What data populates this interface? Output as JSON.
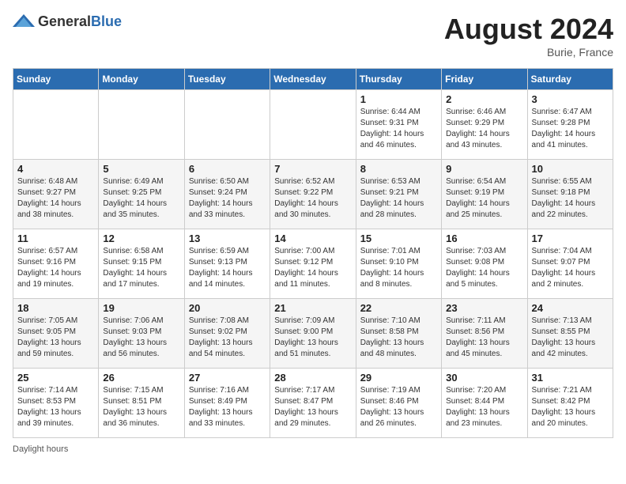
{
  "header": {
    "logo_general": "General",
    "logo_blue": "Blue",
    "month_year": "August 2024",
    "location": "Burie, France"
  },
  "days_of_week": [
    "Sunday",
    "Monday",
    "Tuesday",
    "Wednesday",
    "Thursday",
    "Friday",
    "Saturday"
  ],
  "weeks": [
    [
      {
        "day": "",
        "sunrise": "",
        "sunset": "",
        "daylight": ""
      },
      {
        "day": "",
        "sunrise": "",
        "sunset": "",
        "daylight": ""
      },
      {
        "day": "",
        "sunrise": "",
        "sunset": "",
        "daylight": ""
      },
      {
        "day": "",
        "sunrise": "",
        "sunset": "",
        "daylight": ""
      },
      {
        "day": "1",
        "sunrise": "Sunrise: 6:44 AM",
        "sunset": "Sunset: 9:31 PM",
        "daylight": "Daylight: 14 hours and 46 minutes."
      },
      {
        "day": "2",
        "sunrise": "Sunrise: 6:46 AM",
        "sunset": "Sunset: 9:29 PM",
        "daylight": "Daylight: 14 hours and 43 minutes."
      },
      {
        "day": "3",
        "sunrise": "Sunrise: 6:47 AM",
        "sunset": "Sunset: 9:28 PM",
        "daylight": "Daylight: 14 hours and 41 minutes."
      }
    ],
    [
      {
        "day": "4",
        "sunrise": "Sunrise: 6:48 AM",
        "sunset": "Sunset: 9:27 PM",
        "daylight": "Daylight: 14 hours and 38 minutes."
      },
      {
        "day": "5",
        "sunrise": "Sunrise: 6:49 AM",
        "sunset": "Sunset: 9:25 PM",
        "daylight": "Daylight: 14 hours and 35 minutes."
      },
      {
        "day": "6",
        "sunrise": "Sunrise: 6:50 AM",
        "sunset": "Sunset: 9:24 PM",
        "daylight": "Daylight: 14 hours and 33 minutes."
      },
      {
        "day": "7",
        "sunrise": "Sunrise: 6:52 AM",
        "sunset": "Sunset: 9:22 PM",
        "daylight": "Daylight: 14 hours and 30 minutes."
      },
      {
        "day": "8",
        "sunrise": "Sunrise: 6:53 AM",
        "sunset": "Sunset: 9:21 PM",
        "daylight": "Daylight: 14 hours and 28 minutes."
      },
      {
        "day": "9",
        "sunrise": "Sunrise: 6:54 AM",
        "sunset": "Sunset: 9:19 PM",
        "daylight": "Daylight: 14 hours and 25 minutes."
      },
      {
        "day": "10",
        "sunrise": "Sunrise: 6:55 AM",
        "sunset": "Sunset: 9:18 PM",
        "daylight": "Daylight: 14 hours and 22 minutes."
      }
    ],
    [
      {
        "day": "11",
        "sunrise": "Sunrise: 6:57 AM",
        "sunset": "Sunset: 9:16 PM",
        "daylight": "Daylight: 14 hours and 19 minutes."
      },
      {
        "day": "12",
        "sunrise": "Sunrise: 6:58 AM",
        "sunset": "Sunset: 9:15 PM",
        "daylight": "Daylight: 14 hours and 17 minutes."
      },
      {
        "day": "13",
        "sunrise": "Sunrise: 6:59 AM",
        "sunset": "Sunset: 9:13 PM",
        "daylight": "Daylight: 14 hours and 14 minutes."
      },
      {
        "day": "14",
        "sunrise": "Sunrise: 7:00 AM",
        "sunset": "Sunset: 9:12 PM",
        "daylight": "Daylight: 14 hours and 11 minutes."
      },
      {
        "day": "15",
        "sunrise": "Sunrise: 7:01 AM",
        "sunset": "Sunset: 9:10 PM",
        "daylight": "Daylight: 14 hours and 8 minutes."
      },
      {
        "day": "16",
        "sunrise": "Sunrise: 7:03 AM",
        "sunset": "Sunset: 9:08 PM",
        "daylight": "Daylight: 14 hours and 5 minutes."
      },
      {
        "day": "17",
        "sunrise": "Sunrise: 7:04 AM",
        "sunset": "Sunset: 9:07 PM",
        "daylight": "Daylight: 14 hours and 2 minutes."
      }
    ],
    [
      {
        "day": "18",
        "sunrise": "Sunrise: 7:05 AM",
        "sunset": "Sunset: 9:05 PM",
        "daylight": "Daylight: 13 hours and 59 minutes."
      },
      {
        "day": "19",
        "sunrise": "Sunrise: 7:06 AM",
        "sunset": "Sunset: 9:03 PM",
        "daylight": "Daylight: 13 hours and 56 minutes."
      },
      {
        "day": "20",
        "sunrise": "Sunrise: 7:08 AM",
        "sunset": "Sunset: 9:02 PM",
        "daylight": "Daylight: 13 hours and 54 minutes."
      },
      {
        "day": "21",
        "sunrise": "Sunrise: 7:09 AM",
        "sunset": "Sunset: 9:00 PM",
        "daylight": "Daylight: 13 hours and 51 minutes."
      },
      {
        "day": "22",
        "sunrise": "Sunrise: 7:10 AM",
        "sunset": "Sunset: 8:58 PM",
        "daylight": "Daylight: 13 hours and 48 minutes."
      },
      {
        "day": "23",
        "sunrise": "Sunrise: 7:11 AM",
        "sunset": "Sunset: 8:56 PM",
        "daylight": "Daylight: 13 hours and 45 minutes."
      },
      {
        "day": "24",
        "sunrise": "Sunrise: 7:13 AM",
        "sunset": "Sunset: 8:55 PM",
        "daylight": "Daylight: 13 hours and 42 minutes."
      }
    ],
    [
      {
        "day": "25",
        "sunrise": "Sunrise: 7:14 AM",
        "sunset": "Sunset: 8:53 PM",
        "daylight": "Daylight: 13 hours and 39 minutes."
      },
      {
        "day": "26",
        "sunrise": "Sunrise: 7:15 AM",
        "sunset": "Sunset: 8:51 PM",
        "daylight": "Daylight: 13 hours and 36 minutes."
      },
      {
        "day": "27",
        "sunrise": "Sunrise: 7:16 AM",
        "sunset": "Sunset: 8:49 PM",
        "daylight": "Daylight: 13 hours and 33 minutes."
      },
      {
        "day": "28",
        "sunrise": "Sunrise: 7:17 AM",
        "sunset": "Sunset: 8:47 PM",
        "daylight": "Daylight: 13 hours and 29 minutes."
      },
      {
        "day": "29",
        "sunrise": "Sunrise: 7:19 AM",
        "sunset": "Sunset: 8:46 PM",
        "daylight": "Daylight: 13 hours and 26 minutes."
      },
      {
        "day": "30",
        "sunrise": "Sunrise: 7:20 AM",
        "sunset": "Sunset: 8:44 PM",
        "daylight": "Daylight: 13 hours and 23 minutes."
      },
      {
        "day": "31",
        "sunrise": "Sunrise: 7:21 AM",
        "sunset": "Sunset: 8:42 PM",
        "daylight": "Daylight: 13 hours and 20 minutes."
      }
    ]
  ],
  "footer": {
    "daylight_label": "Daylight hours"
  }
}
